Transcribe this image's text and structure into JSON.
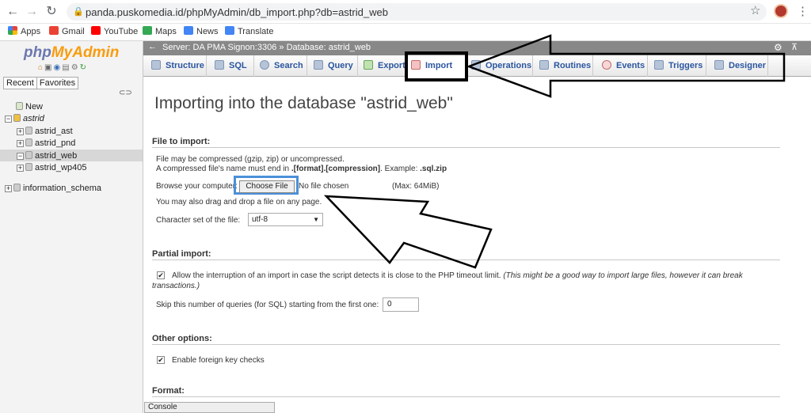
{
  "browser": {
    "url": "panda.puskomedia.id/phpMyAdmin/db_import.php?db=astrid_web",
    "bookmarks": [
      "Apps",
      "Gmail",
      "YouTube",
      "Maps",
      "News",
      "Translate"
    ]
  },
  "sidebar": {
    "logo_php": "php",
    "logo_myadmin": "MyAdmin",
    "tabs": [
      "Recent",
      "Favorites"
    ],
    "tree": [
      {
        "label": "New"
      },
      {
        "label": "astrid"
      },
      {
        "label": "astrid_ast"
      },
      {
        "label": "astrid_pnd"
      },
      {
        "label": "astrid_web"
      },
      {
        "label": "astrid_wp405"
      },
      {
        "label": "information_schema"
      }
    ]
  },
  "topbar": {
    "server": "Server: DA PMA Signon:3306",
    "separator": "»",
    "database": "Database: astrid_web"
  },
  "tabs": [
    "Structure",
    "SQL",
    "Search",
    "Query",
    "Export",
    "Import",
    "Operations",
    "Routines",
    "Events",
    "Triggers",
    "Designer"
  ],
  "main": {
    "title": "Importing into the database \"astrid_web\"",
    "file_section": "File to import:",
    "compress_line1": "File may be compressed (gzip, zip) or uncompressed.",
    "compress_line2_a": "A compressed file's name must end in ",
    "compress_line2_b": ".[format].[compression]",
    "compress_line2_c": ". Example: ",
    "compress_line2_d": ".sql.zip",
    "browse_label": "Browse your computer:",
    "choose_file": "Choose File",
    "no_file": "No file chosen",
    "max_size": "(Max: 64MiB)",
    "drag_drop": "You may also drag and drop a file on any page.",
    "charset_label": "Character set of the file:",
    "charset_value": "utf-8",
    "partial_section": "Partial import:",
    "allow_interrupt": "Allow the interruption of an import in case the script detects it is close to the PHP timeout limit.",
    "allow_interrupt_note": "(This might be a good way to import large files, however it can break",
    "allow_interrupt_note2": "transactions.)",
    "skip_label": "Skip this number of queries (for SQL) starting from the first one:",
    "skip_value": "0",
    "other_section": "Other options:",
    "foreign_keys": "Enable foreign key checks",
    "format_section": "Format:",
    "console": "Console"
  },
  "colors": {
    "annotation": "#000000",
    "highlight": "#4a90d9"
  }
}
